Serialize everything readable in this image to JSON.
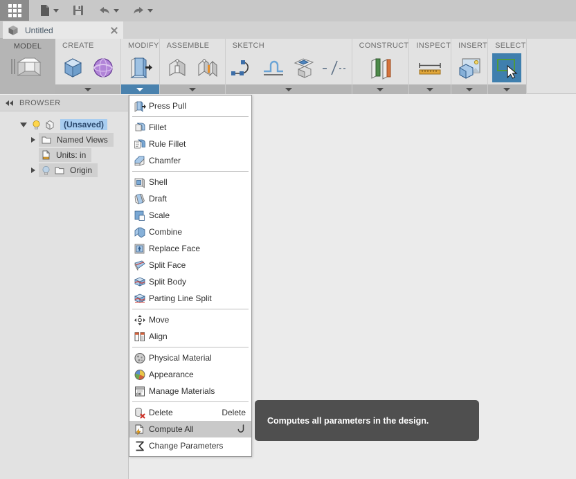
{
  "quick_access": {
    "items": [
      {
        "name": "app-grid-button",
        "icon": "grid-icon",
        "label": ""
      },
      {
        "name": "new-file-button",
        "icon": "file-icon",
        "label": "",
        "has_caret": true
      },
      {
        "name": "save-button",
        "icon": "save-icon",
        "label": "",
        "has_caret": false
      },
      {
        "name": "undo-button",
        "icon": "undo-icon",
        "label": "",
        "has_caret": true
      },
      {
        "name": "redo-button",
        "icon": "redo-icon",
        "label": "",
        "has_caret": true
      }
    ]
  },
  "document_tab": {
    "title": "Untitled",
    "icon": "cube-icon",
    "close_icon": "close-icon"
  },
  "ribbon": {
    "workspace_tab": {
      "label": "MODEL",
      "icon": "model-cube-icon"
    },
    "panels": [
      {
        "title": "CREATE",
        "dropdown_highlighted": false,
        "buttons": [
          {
            "name": "create-box-button",
            "icon": "box-icon",
            "selected": false
          },
          {
            "name": "create-sphere-button",
            "icon": "sphere-icon",
            "selected": false
          }
        ]
      },
      {
        "title": "MODIFY",
        "dropdown_highlighted": true,
        "buttons": [
          {
            "name": "modify-press-pull-button",
            "icon": "press-pull-icon",
            "selected": false
          }
        ]
      },
      {
        "title": "ASSEMBLE",
        "dropdown_highlighted": false,
        "buttons": [
          {
            "name": "assemble-new-component-button",
            "icon": "component-icon",
            "selected": false
          },
          {
            "name": "assemble-joint-button",
            "icon": "joint-icon",
            "selected": false
          }
        ]
      },
      {
        "title": "SKETCH",
        "dropdown_highlighted": false,
        "buttons": [
          {
            "name": "sketch-spline-button",
            "icon": "spline-icon",
            "selected": false
          },
          {
            "name": "sketch-create-sketch-button",
            "icon": "create-sketch-icon",
            "selected": false
          },
          {
            "name": "sketch-offset-plane-button",
            "icon": "offset-plane-icon",
            "selected": false
          },
          {
            "name": "sketch-construction-line-button",
            "icon": "construction-line-icon",
            "selected": false
          }
        ]
      },
      {
        "title": "CONSTRUCT",
        "dropdown_highlighted": false,
        "buttons": [
          {
            "name": "construct-plane-button",
            "icon": "construct-plane-icon",
            "selected": false
          }
        ]
      },
      {
        "title": "INSPECT",
        "dropdown_highlighted": false,
        "buttons": [
          {
            "name": "inspect-measure-button",
            "icon": "ruler-icon",
            "selected": false
          }
        ]
      },
      {
        "title": "INSERT",
        "dropdown_highlighted": false,
        "buttons": [
          {
            "name": "insert-decal-button",
            "icon": "insert-image-icon",
            "selected": false
          }
        ]
      },
      {
        "title": "SELECT",
        "dropdown_highlighted": false,
        "buttons": [
          {
            "name": "select-window-button",
            "icon": "select-cursor-icon",
            "selected": true
          }
        ]
      }
    ]
  },
  "browser": {
    "title": "BROWSER",
    "collapse_icon": "collapse-left-icon",
    "tree": [
      {
        "label": "(Unsaved)",
        "indent": 0,
        "arrow": "expanded",
        "has_bulb": true,
        "icon": "component-cube-icon",
        "highlighted": true
      },
      {
        "label": "Named Views",
        "indent": 1,
        "arrow": "collapsed",
        "has_bulb": false,
        "icon": "folder-icon",
        "highlighted": false
      },
      {
        "label": "Units: in",
        "indent": 1,
        "arrow": "none",
        "has_bulb": false,
        "icon": "units-doc-icon",
        "highlighted": false
      },
      {
        "label": "Origin",
        "indent": 1,
        "arrow": "collapsed",
        "has_bulb": true,
        "icon": "folder-icon",
        "highlighted": false
      }
    ]
  },
  "modify_menu": {
    "items": [
      {
        "type": "item",
        "label": "Press Pull",
        "icon": "press-pull-icon",
        "accel": "",
        "active": false,
        "hook": false
      },
      {
        "type": "separator"
      },
      {
        "type": "item",
        "label": "Fillet",
        "icon": "fillet-icon",
        "accel": "",
        "active": false,
        "hook": false
      },
      {
        "type": "item",
        "label": "Rule Fillet",
        "icon": "rule-fillet-icon",
        "accel": "",
        "active": false,
        "hook": false
      },
      {
        "type": "item",
        "label": "Chamfer",
        "icon": "chamfer-icon",
        "accel": "",
        "active": false,
        "hook": false
      },
      {
        "type": "separator"
      },
      {
        "type": "item",
        "label": "Shell",
        "icon": "shell-icon",
        "accel": "",
        "active": false,
        "hook": false
      },
      {
        "type": "item",
        "label": "Draft",
        "icon": "draft-icon",
        "accel": "",
        "active": false,
        "hook": false
      },
      {
        "type": "item",
        "label": "Scale",
        "icon": "scale-icon",
        "accel": "",
        "active": false,
        "hook": false
      },
      {
        "type": "item",
        "label": "Combine",
        "icon": "combine-icon",
        "accel": "",
        "active": false,
        "hook": false
      },
      {
        "type": "item",
        "label": "Replace Face",
        "icon": "replace-face-icon",
        "accel": "",
        "active": false,
        "hook": false
      },
      {
        "type": "item",
        "label": "Split Face",
        "icon": "split-face-icon",
        "accel": "",
        "active": false,
        "hook": false
      },
      {
        "type": "item",
        "label": "Split Body",
        "icon": "split-body-icon",
        "accel": "",
        "active": false,
        "hook": false
      },
      {
        "type": "item",
        "label": "Parting Line Split",
        "icon": "parting-line-split-icon",
        "accel": "",
        "active": false,
        "hook": false
      },
      {
        "type": "separator"
      },
      {
        "type": "item",
        "label": "Move",
        "icon": "move-icon",
        "accel": "",
        "active": false,
        "hook": false
      },
      {
        "type": "item",
        "label": "Align",
        "icon": "align-icon",
        "accel": "",
        "active": false,
        "hook": false
      },
      {
        "type": "separator"
      },
      {
        "type": "item",
        "label": "Physical Material",
        "icon": "physical-material-icon",
        "accel": "",
        "active": false,
        "hook": false
      },
      {
        "type": "item",
        "label": "Appearance",
        "icon": "appearance-icon",
        "accel": "",
        "active": false,
        "hook": false
      },
      {
        "type": "item",
        "label": "Manage Materials",
        "icon": "manage-materials-icon",
        "accel": "",
        "active": false,
        "hook": false
      },
      {
        "type": "separator"
      },
      {
        "type": "item",
        "label": "Delete",
        "icon": "delete-icon",
        "accel": "Delete",
        "active": false,
        "hook": false
      },
      {
        "type": "item",
        "label": "Compute All",
        "icon": "compute-all-icon",
        "accel": "",
        "active": true,
        "hook": true
      },
      {
        "type": "item",
        "label": "Change Parameters",
        "icon": "change-parameters-icon",
        "accel": "",
        "active": false,
        "hook": false
      }
    ]
  },
  "tooltip": {
    "text": "Computes all parameters in the design."
  },
  "colors": {
    "accent_blue": "#4a82ae",
    "selection_blue": "#a8cdf0",
    "ribbon_bg": "#e2e2e2",
    "toolbar_bg": "#c8c8c8",
    "tooltip_bg": "#4f4f4f",
    "menu_active": "#c9c9c9"
  }
}
